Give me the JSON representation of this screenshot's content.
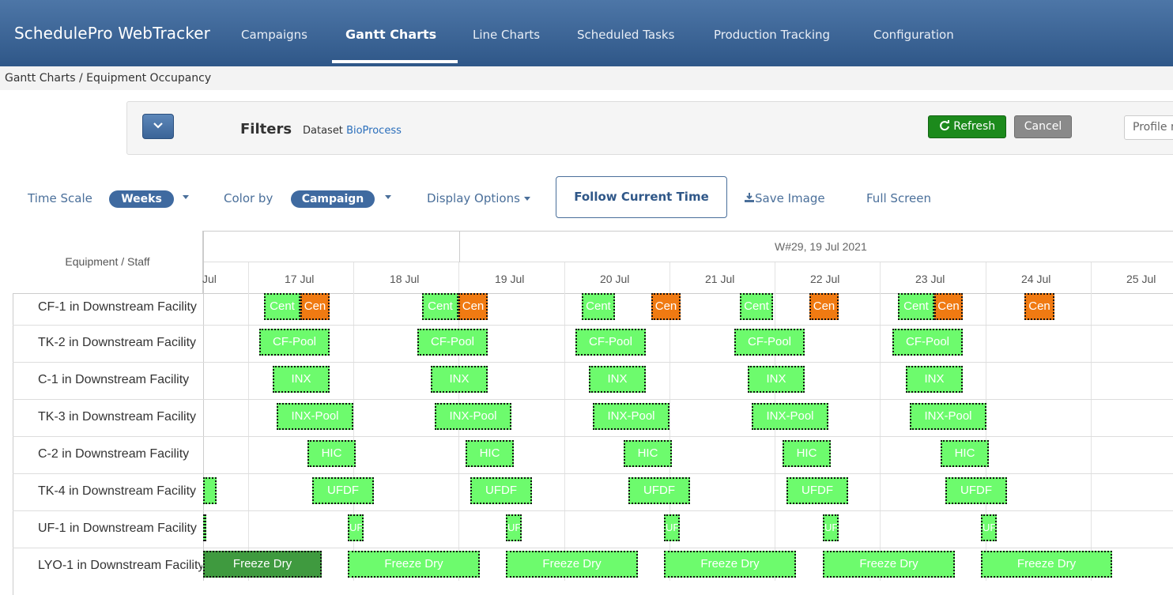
{
  "app": {
    "title": "SchedulePro WebTracker"
  },
  "nav": [
    {
      "label": "Campaigns"
    },
    {
      "label": "Gantt Charts"
    },
    {
      "label": "Line Charts"
    },
    {
      "label": "Scheduled Tasks"
    },
    {
      "label": "Production Tracking"
    },
    {
      "label": "Configuration"
    }
  ],
  "breadcrumb": "Gantt Charts / Equipment Occupancy",
  "filters": {
    "title": "Filters",
    "dataset_label": "Dataset",
    "dataset_value": "BioProcess",
    "refresh_label": "Refresh",
    "cancel_label": "Cancel",
    "profile_placeholder": "Profile n"
  },
  "toolbar": {
    "time_scale_label": "Time Scale",
    "time_scale_value": "Weeks",
    "color_by_label": "Color by",
    "color_by_value": "Campaign",
    "display_options_label": "Display Options",
    "follow_label": "Follow Current Time",
    "save_image_label": "Save Image",
    "full_screen_label": "Full Screen"
  },
  "gantt": {
    "equipment_header": "Equipment / Staff",
    "week_label": "W#29, 19 Jul 2021",
    "days": [
      "Jul",
      "17 Jul",
      "18 Jul",
      "19 Jul",
      "20 Jul",
      "21 Jul",
      "22 Jul",
      "23 Jul",
      "24 Jul",
      "25 Jul"
    ],
    "rows": [
      "CF-1 in Downstream Facility",
      "TK-2 in Downstream Facility",
      "C-1 in Downstream Facility",
      "TK-3 in Downstream Facility",
      "C-2 in Downstream Facility",
      "TK-4 in Downstream Facility",
      "UF-1 in Downstream Facility",
      "LYO-1 in Downstream Facility"
    ],
    "bar_labels": {
      "cent": "Cent",
      "cen": "Cen",
      "cfpool": "CF-Pool",
      "inx": "INX",
      "inxpool": "INX-Pool",
      "hic": "HIC",
      "ufdf": "UFDF",
      "uf": "UF",
      "freezedry": "Freeze Dry"
    },
    "colors": {
      "green": "#6dfb6d",
      "orange": "#f07a12",
      "selected": "#3f9a3f"
    }
  }
}
